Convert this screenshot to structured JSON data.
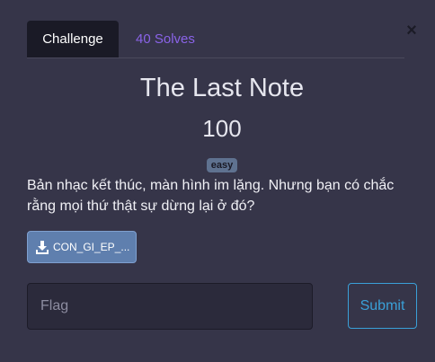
{
  "tabs": {
    "challenge_label": "Challenge",
    "solves_label": "40 Solves"
  },
  "close_icon": "close-icon",
  "challenge": {
    "title": "The Last Note",
    "points": "100",
    "difficulty": "easy",
    "description": "Bản nhạc kết thúc, màn hình im lặng. Nhưng bạn có chắc rằng mọi thứ thật sự dừng lại ở đó?"
  },
  "file": {
    "label": "CON_GI_EP_...",
    "icon": "download-icon"
  },
  "flag": {
    "placeholder": "Flag",
    "value": ""
  },
  "submit_label": "Submit",
  "colors": {
    "background": "#363549",
    "active_tab": "#1a1a26",
    "solves_link": "#8a63e8",
    "submit_accent": "#3aa0d8",
    "download_button": "#5f7fae",
    "badge": "#5f7290"
  }
}
